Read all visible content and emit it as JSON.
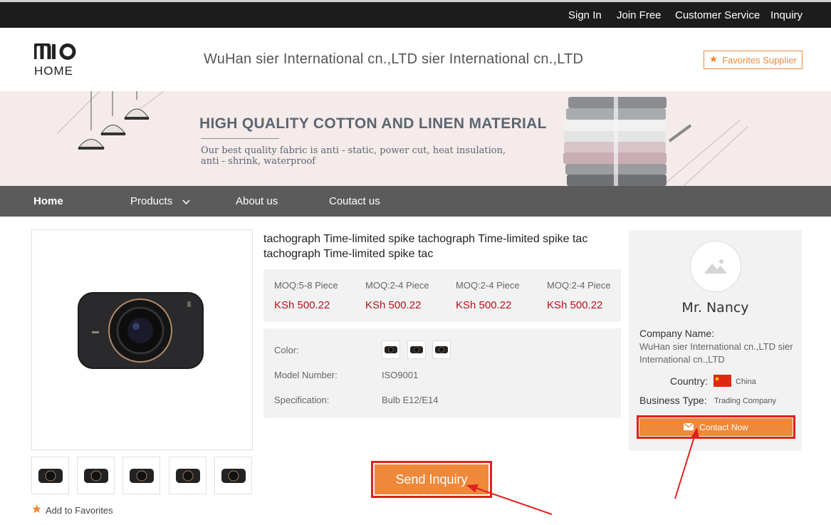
{
  "topbar": {
    "links": [
      "Sign In",
      "Join Free",
      "Customer Service",
      "Inquiry"
    ]
  },
  "header": {
    "logo_top": "mio",
    "logo_bottom": "HOME",
    "company_title": "WuHan sier International cn.,LTD sier International cn.,LTD",
    "favorites_supplier_label": "Favorites Supplier"
  },
  "banner": {
    "headline": "HIGH QUALITY COTTON AND LINEN MATERIAL",
    "subtext": "Our best quality fabric is anti - static, power cut, heat insulation, anti - shrink, waterproof"
  },
  "nav": {
    "items": [
      "Home",
      "Products",
      "About us",
      "Coutact us"
    ],
    "active": "Home"
  },
  "gallery": {
    "thumbnail_count": 5,
    "add_to_favorites_label": "Add to Favorites"
  },
  "product": {
    "title": "tachograph Time-limited spike tachograph Time-limited spike tac tachograph Time-limited spike tac",
    "tiers": [
      {
        "moq": "MOQ:5-8 Piece",
        "price": "KSh 500.22"
      },
      {
        "moq": "MOQ:2-4 Piece",
        "price": "KSh 500.22"
      },
      {
        "moq": "MOQ:2-4 Piece",
        "price": "KSh 500.22"
      },
      {
        "moq": "MOQ:2-4 Piece",
        "price": "KSh 500.22"
      }
    ],
    "color_label": "Color:",
    "model_label": "Model Number:",
    "model_value": "ISO9001",
    "spec_label": "Specification:",
    "spec_value": "Bulb E12/E14",
    "send_inquiry_label": "Send Inquiry"
  },
  "supplier": {
    "contact_name": "Mr. Nancy",
    "company_name_label": "Company Name:",
    "company_name_value": "WuHan sier International cn.,LTD sier International cn.,LTD",
    "country_label": "Country:",
    "country_value": "China",
    "business_type_label": "Business Type:",
    "business_type_value": "Trading Company",
    "contact_now_label": "Contact Now"
  },
  "colors": {
    "accent_orange": "#f0883a",
    "price_red": "#b8121d",
    "annotation_red": "#e0211d",
    "topbar_bg": "#1c1c1c",
    "nav_bg": "#5b5b5b"
  }
}
